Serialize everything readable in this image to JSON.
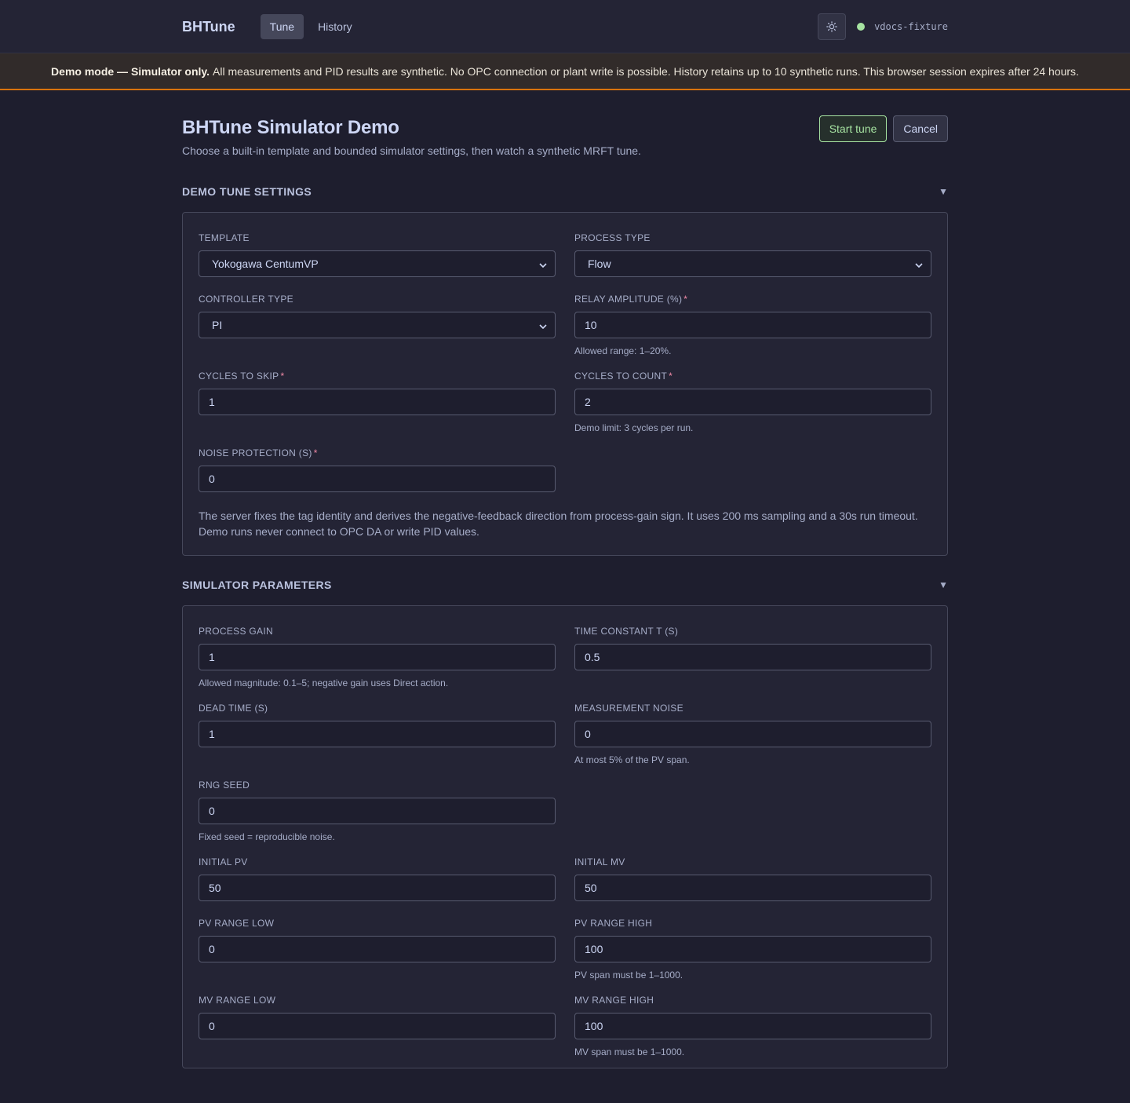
{
  "header": {
    "brand": "BHTune",
    "tabs": [
      {
        "label": "Tune",
        "active": true
      },
      {
        "label": "History",
        "active": false
      }
    ],
    "theme_icon": "sun-icon",
    "status_label": "vdocs-fixture",
    "status_color": "#a6e3a1"
  },
  "banner": {
    "bold": "Demo mode — Simulator only.",
    "text": "All measurements and PID results are synthetic. No OPC connection or plant write is possible. History retains up to 10 synthetic runs. This browser session expires after 24 hours.",
    "accent": "#d9730d"
  },
  "page": {
    "title": "BHTune Simulator Demo",
    "subtitle": "Choose a built-in template and bounded simulator settings, then watch a synthetic MRFT tune.",
    "start_label": "Start tune",
    "cancel_label": "Cancel"
  },
  "settings": {
    "title": "DEMO TUNE SETTINGS",
    "template": {
      "label": "TEMPLATE",
      "value": "Yokogawa CentumVP"
    },
    "process_type": {
      "label": "PROCESS TYPE",
      "value": "Flow"
    },
    "controller_type": {
      "label": "CONTROLLER TYPE",
      "value": "PI"
    },
    "relay_amplitude": {
      "label": "RELAY AMPLITUDE (%)",
      "value": "10",
      "hint": "Allowed range: 1–20%."
    },
    "cycles_skip": {
      "label": "CYCLES TO SKIP",
      "value": "1"
    },
    "cycles_count": {
      "label": "CYCLES TO COUNT",
      "value": "2",
      "hint": "Demo limit: 3 cycles per run."
    },
    "noise_protection": {
      "label": "NOISE PROTECTION (S)",
      "value": "0"
    },
    "note": "The server fixes the tag identity and derives the negative-feedback direction from process-gain sign. It uses 200 ms sampling and a 30s run timeout. Demo runs never connect to OPC DA or write PID values."
  },
  "simulator": {
    "title": "SIMULATOR PARAMETERS",
    "process_gain": {
      "label": "PROCESS GAIN",
      "value": "1",
      "hint": "Allowed magnitude: 0.1–5; negative gain uses Direct action."
    },
    "time_constant": {
      "label": "TIME CONSTANT T (S)",
      "value": "0.5"
    },
    "dead_time": {
      "label": "DEAD TIME (S)",
      "value": "1"
    },
    "measurement_noise": {
      "label": "MEASUREMENT NOISE",
      "value": "0",
      "hint": "At most 5% of the PV span."
    },
    "rng_seed": {
      "label": "RNG SEED",
      "value": "0",
      "hint": "Fixed seed = reproducible noise."
    },
    "initial_pv": {
      "label": "INITIAL PV",
      "value": "50"
    },
    "initial_mv": {
      "label": "INITIAL MV",
      "value": "50"
    },
    "pv_low": {
      "label": "PV RANGE LOW",
      "value": "0"
    },
    "pv_high": {
      "label": "PV RANGE HIGH",
      "value": "100",
      "hint": "PV span must be 1–1000."
    },
    "mv_low": {
      "label": "MV RANGE LOW",
      "value": "0"
    },
    "mv_high": {
      "label": "MV RANGE HIGH",
      "value": "100",
      "hint": "MV span must be 1–1000."
    }
  }
}
